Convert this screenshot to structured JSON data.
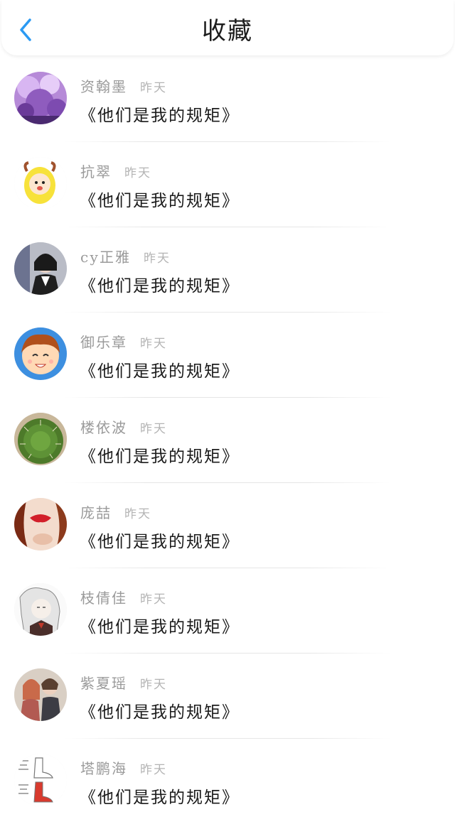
{
  "header": {
    "title": "收藏",
    "back_icon": "chevron-left-icon",
    "accent_color": "#2b9af3"
  },
  "items": [
    {
      "name": "资翰墨",
      "time": "昨天",
      "title": "《他们是我的规矩》"
    },
    {
      "name": "抗翠",
      "time": "昨天",
      "title": "《他们是我的规矩》"
    },
    {
      "name": "су正雅",
      "time": "昨天",
      "title": "《他们是我的规矩》"
    },
    {
      "name": "御乐章",
      "time": "昨天",
      "title": "《他们是我的规矩》"
    },
    {
      "name": "楼依波",
      "time": "昨天",
      "title": "《他们是我的规矩》"
    },
    {
      "name": "庞喆",
      "time": "昨天",
      "title": "《他们是我的规矩》"
    },
    {
      "name": "枝倩佳",
      "time": "昨天",
      "title": "《他们是我的规矩》"
    },
    {
      "name": "紫夏瑶",
      "time": "昨天",
      "title": "《他们是我的规矩》"
    },
    {
      "name": "塔鹏海",
      "time": "昨天",
      "title": "《他们是我的规矩》"
    }
  ]
}
